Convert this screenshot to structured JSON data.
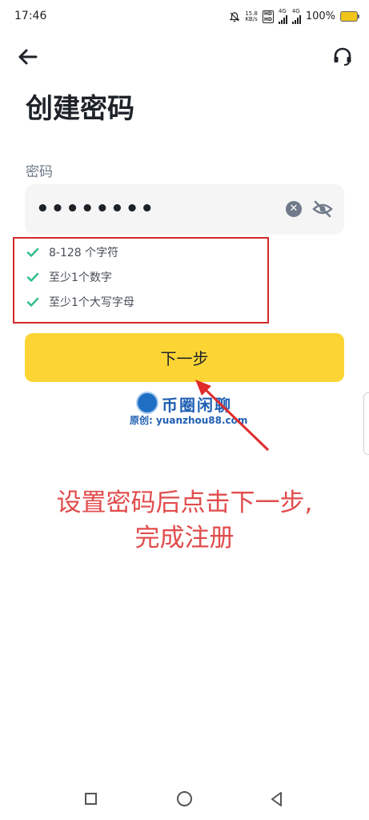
{
  "status_bar": {
    "time": "17:46",
    "net_speed_value": "15.8",
    "net_speed_unit": "KB/s",
    "hd1": "HD",
    "hd2": "HD",
    "sig1_label": "4G",
    "sig2_label": "4G",
    "battery": "100%"
  },
  "header": {
    "back_icon": "arrow-left-icon",
    "support_icon": "headset-icon"
  },
  "page": {
    "title": "创建密码",
    "password_label": "密码",
    "password_value": "••••••••",
    "clear_icon": "clear-circle-icon",
    "visibility_icon": "eye-off-icon"
  },
  "requirements": [
    {
      "text": "8-128 个字符",
      "met": true
    },
    {
      "text": "至少1个数字",
      "met": true
    },
    {
      "text": "至少1个大写字母",
      "met": true
    }
  ],
  "next_button_label": "下一步",
  "watermark": {
    "brand": "币圈闲聊",
    "logo_text": "币圈闲聊",
    "url": "原创: yuanzhou88.com"
  },
  "annotation": {
    "line1": "设置密码后点击下一步,",
    "line2": "完成注册"
  },
  "colors": {
    "accent_yellow": "#fcd535",
    "check_green": "#2ebd85",
    "annotation_red": "#e14c4c",
    "highlight_border": "#d42a2a"
  },
  "nav_bar": {
    "recent_icon": "square-icon",
    "home_icon": "circle-icon",
    "back_icon": "triangle-back-icon"
  }
}
